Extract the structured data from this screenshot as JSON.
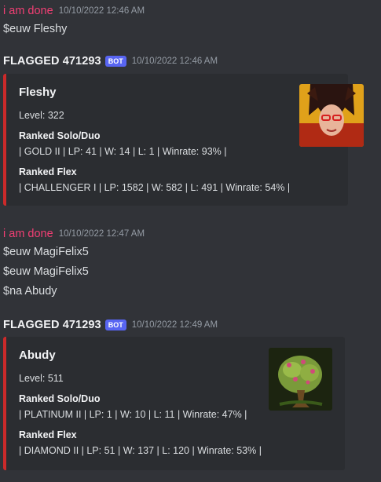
{
  "messages": [
    {
      "author": "i am done",
      "timestamp": "10/10/2022 12:46 AM",
      "lines": [
        "$euw Fleshy"
      ]
    },
    {
      "author": "FLAGGED 471293",
      "bot_tag": "BOT",
      "timestamp": "10/10/2022 12:46 AM",
      "embed": {
        "title": "Fleshy",
        "level": "Level: 322",
        "solo_label": "Ranked Solo/Duo",
        "solo_value": "| GOLD II | LP: 41 | W: 14 | L: 1 | Winrate: 93% |",
        "flex_label": "Ranked Flex",
        "flex_value": "| CHALLENGER I | LP: 1582 | W: 582 | L: 491 | Winrate: 54% |",
        "thumbnail": "champion-portrait-icon"
      }
    },
    {
      "author": "i am done",
      "timestamp": "10/10/2022 12:47 AM",
      "lines": [
        "$euw MagiFelix5",
        "$euw MagiFelix5",
        "$na Abudy"
      ]
    },
    {
      "author": "FLAGGED 471293",
      "bot_tag": "BOT",
      "timestamp": "10/10/2022 12:49 AM",
      "embed": {
        "title": "Abudy",
        "level": "Level: 511",
        "solo_label": "Ranked Solo/Duo",
        "solo_value": "| PLATINUM II | LP: 1 | W: 10 | L: 11 | Winrate: 47% |",
        "flex_label": "Ranked Flex",
        "flex_value": "| DIAMOND II | LP: 51 | W: 137 | L: 120 | Winrate: 53% |",
        "thumbnail": "tree-icon"
      }
    }
  ],
  "colors": {
    "background": "#313338",
    "embed_background": "#2b2d31",
    "embed_accent": "#cc2a2a",
    "user_name": "#f23f74",
    "bot_tag": "#5865f2",
    "timestamp": "#949ba4"
  }
}
